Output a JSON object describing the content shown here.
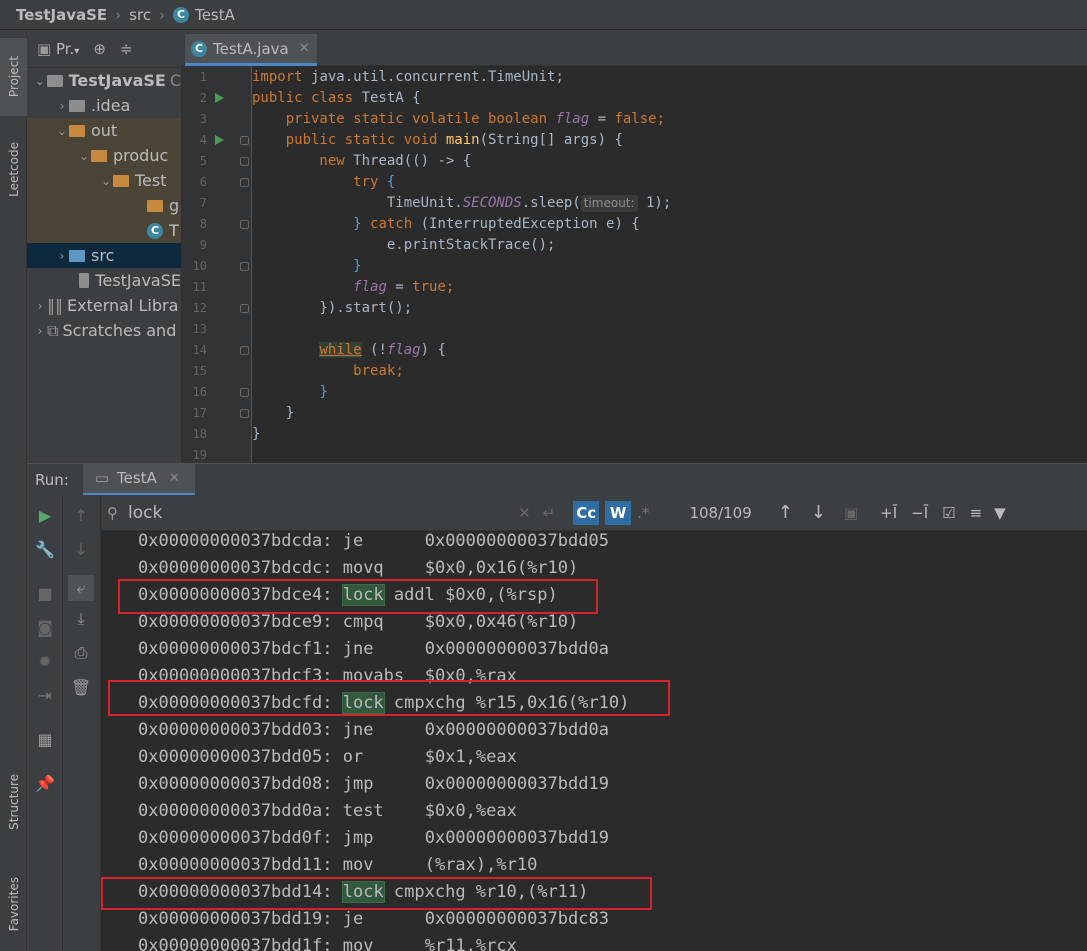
{
  "breadcrumb": {
    "project": "TestJavaSE",
    "folder": "src",
    "file": "TestA"
  },
  "left_strip": {
    "project": "Project",
    "leetcode": "Leetcode",
    "structure": "Structure",
    "favorites": "Favorites"
  },
  "project_panel": {
    "header": "Pr.",
    "tree": [
      {
        "label": "TestJavaSE",
        "suffix": "C"
      },
      {
        "label": ".idea"
      },
      {
        "label": "out"
      },
      {
        "label": "produc"
      },
      {
        "label": "Test"
      },
      {
        "label": "g"
      },
      {
        "label": "T"
      },
      {
        "label": "src"
      },
      {
        "label": "TestJavaSE"
      },
      {
        "label": "External Libra"
      },
      {
        "label": "Scratches and"
      }
    ]
  },
  "editor": {
    "tab_label": "TestA.java",
    "line_numbers": [
      "1",
      "2",
      "3",
      "4",
      "5",
      "6",
      "7",
      "8",
      "9",
      "10",
      "11",
      "12",
      "13",
      "14",
      "15",
      "16",
      "17",
      "18",
      "19"
    ],
    "code": {
      "l1a": "import ",
      "l1b": "java.util.concurrent.TimeUnit;",
      "l2a": "public class ",
      "l2b": "TestA {",
      "l3a": "    private static volatile boolean ",
      "l3b": "flag",
      "l3c": " = ",
      "l3d": "false",
      "l3e": ";",
      "l4a": "    public static void ",
      "l4b": "main",
      "l4c": "(String[] args) {",
      "l5a": "        new ",
      "l5b": "Thread(() -> {",
      "l6a": "            try ",
      "l6b": "{",
      "l7a": "                TimeUnit.",
      "l7b": "SECONDS",
      "l7c": ".sleep(",
      "l7hint": "timeout:",
      "l7d": " 1);",
      "l8a": "            } ",
      "l8b": "catch ",
      "l8c": "(InterruptedException e) {",
      "l9a": "                e.printStackTrace();",
      "l10a": "            }",
      "l11a": "            ",
      "l11b": "flag",
      "l11c": " = ",
      "l11d": "true",
      "l11e": ";",
      "l12a": "        }).start();",
      "l14a": "        ",
      "l14b": "while",
      "l14c": " (!",
      "l14d": "flag",
      "l14e": ") {",
      "l15a": "            ",
      "l15b": "break",
      "l15c": ";",
      "l16a": "        }",
      "l17a": "    }",
      "l18a": "}"
    }
  },
  "run_panel": {
    "label": "Run:",
    "tab_label": "TestA",
    "search_value": "lock",
    "match_case_label": "Cc",
    "words_label": "W",
    "regex_label": ".*",
    "match_count": "108/109"
  },
  "asm_lines": [
    {
      "addr": "0x00000000037bdcda:",
      "mnem": "je",
      "args": "0x00000000037bdd05",
      "lock": false
    },
    {
      "addr": "0x00000000037bdcdc:",
      "mnem": "movq",
      "args": "$0x0,0x16(%r10)",
      "lock": false
    },
    {
      "addr": "0x00000000037bdce4:",
      "mnem": "lock",
      "args": "addl $0x0,(%rsp)",
      "lock": true
    },
    {
      "addr": "0x00000000037bdce9:",
      "mnem": "cmpq",
      "args": "$0x0,0x46(%r10)",
      "lock": false
    },
    {
      "addr": "0x00000000037bdcf1:",
      "mnem": "jne",
      "args": "0x00000000037bdd0a",
      "lock": false
    },
    {
      "addr": "0x00000000037bdcf3:",
      "mnem": "movabs",
      "args": "$0x0,%rax",
      "lock": false
    },
    {
      "addr": "0x00000000037bdcfd:",
      "mnem": "lock",
      "args": "cmpxchg %r15,0x16(%r10)",
      "lock": true
    },
    {
      "addr": "0x00000000037bdd03:",
      "mnem": "jne",
      "args": "0x00000000037bdd0a",
      "lock": false
    },
    {
      "addr": "0x00000000037bdd05:",
      "mnem": "or",
      "args": "$0x1,%eax",
      "lock": false
    },
    {
      "addr": "0x00000000037bdd08:",
      "mnem": "jmp",
      "args": "0x00000000037bdd19",
      "lock": false
    },
    {
      "addr": "0x00000000037bdd0a:",
      "mnem": "test",
      "args": "$0x0,%eax",
      "lock": false
    },
    {
      "addr": "0x00000000037bdd0f:",
      "mnem": "jmp",
      "args": "0x00000000037bdd19",
      "lock": false
    },
    {
      "addr": "0x00000000037bdd11:",
      "mnem": "mov",
      "args": "(%rax),%r10",
      "lock": false
    },
    {
      "addr": "0x00000000037bdd14:",
      "mnem": "lock",
      "args": "cmpxchg %r10,(%r11)",
      "lock": true
    },
    {
      "addr": "0x00000000037bdd19:",
      "mnem": "je",
      "args": "0x00000000037bdc83",
      "lock": false
    },
    {
      "addr": "0x00000000037bdd1f:",
      "mnem": "mov",
      "args": "%r11,%rcx",
      "lock": false
    }
  ],
  "colors": {
    "accent": "#4a88c7",
    "highlight_box": "#d7222c",
    "match_bg": "#32593d"
  }
}
